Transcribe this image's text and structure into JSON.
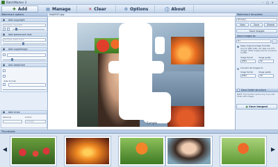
{
  "window": {
    "title": "BatchMarker 3",
    "controls": [
      "–",
      "□",
      "×"
    ]
  },
  "toolbar": {
    "buttons": [
      {
        "label": "Add",
        "icon": "plus-icon",
        "glyph": "✚"
      },
      {
        "label": "Manage",
        "icon": "manage-icon",
        "glyph": "▤"
      },
      {
        "label": "Clear",
        "icon": "clear-icon",
        "glyph": "✕"
      },
      {
        "label": "Options",
        "icon": "options-icon",
        "glyph": "⚙"
      },
      {
        "label": "About",
        "icon": "info-icon",
        "glyph": "ⓘ"
      }
    ]
  },
  "left_panel": {
    "title": "Watermark options",
    "sections": {
      "copyright": {
        "title": "Add copyright",
        "input_value": "Sample copyright"
      },
      "watermark": {
        "title": "Add watermark text",
        "input_value": "Sample watermark"
      },
      "logo": {
        "title": "Add Logo/Image"
      },
      "date": {
        "title": "Add date/time",
        "label": "date format"
      },
      "lines": {
        "title": "Add Lines",
        "spacing_label": "Spacing",
        "colour_label": "Colour",
        "style_value": "orange"
      }
    }
  },
  "main": {
    "tab_label": "img0021.jpg",
    "caption": "Sample"
  },
  "right_panel": {
    "title": "Watermark templates",
    "template_value": "(Empty)",
    "buttons": {
      "new": "New",
      "save": "Save",
      "delete": "Delete"
    },
    "load_button": "Save images",
    "save_section_title": "Save images to:",
    "save_path": "D:\\",
    "options": {
      "keep_original": "Keep original image formats",
      "keep_note": "Only for BMP, JPEG, GIF, PNG and TIFF images. Other images will be converted to JPEG",
      "image_format_label": "Image format",
      "image_quality_label": "Image quality",
      "image_format_value": "JPEG",
      "image_quality_value": "90",
      "convert_all": "Convert all images to:",
      "format2_value": "JPEG",
      "quality2_value": "90"
    },
    "folder_title": "Save folder structure",
    "folder_note": "NOTE: This function works only if you add folder with images",
    "save_images_button": "Save Images!"
  },
  "thumbnails": {
    "title": "Thumbnails",
    "prev": "◀",
    "next": "▶",
    "count": 5
  },
  "colors": {
    "accent": "#3c7a2e",
    "toolbar_bg": "#c3d4ea",
    "panel_bg": "#e4edf8"
  }
}
